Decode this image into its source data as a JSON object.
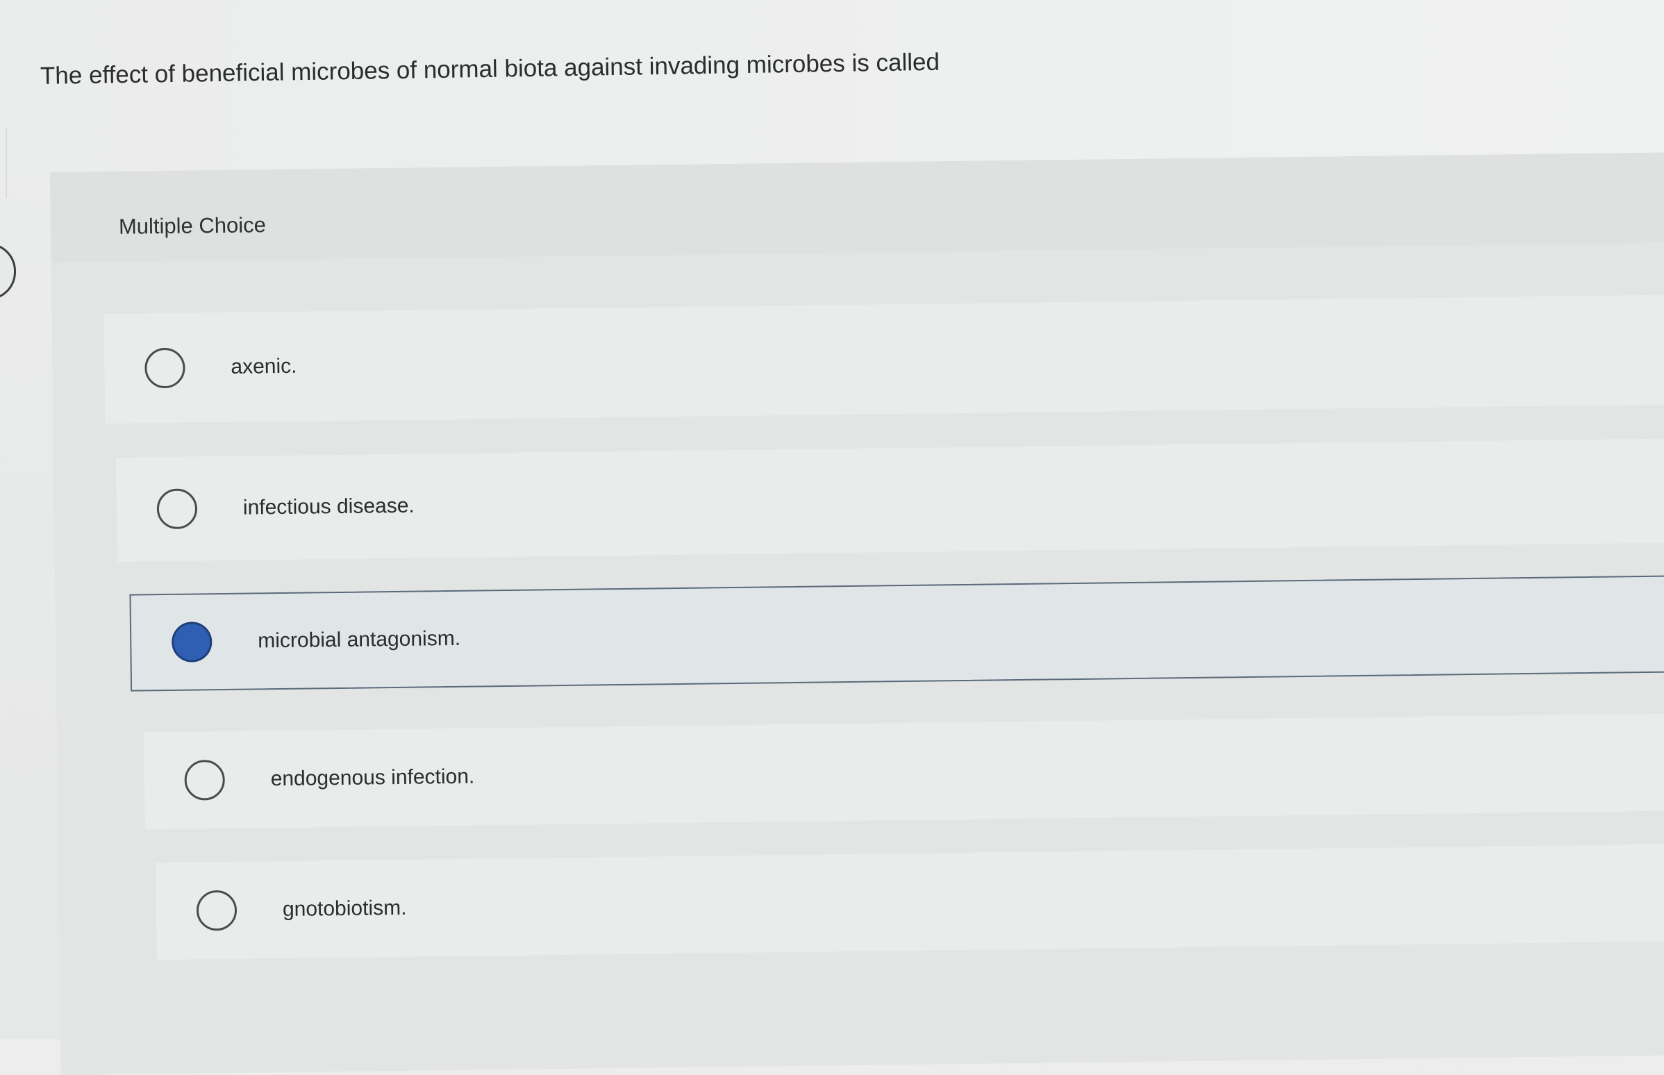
{
  "question": {
    "text": "The effect of beneficial microbes of normal biota against invading microbes is called"
  },
  "panel": {
    "header_label": "Multiple Choice"
  },
  "options": [
    {
      "label": "axenic.",
      "selected": false
    },
    {
      "label": "infectious disease.",
      "selected": false
    },
    {
      "label": "microbial antagonism.",
      "selected": true
    },
    {
      "label": "endogenous infection.",
      "selected": false
    },
    {
      "label": "gnotobiotism.",
      "selected": false
    }
  ],
  "colors": {
    "selected_radio": "#2f5fb3",
    "selected_border": "#5a6a7a"
  },
  "icons": {
    "unselected": "radio-empty-icon",
    "selected": "radio-filled-icon"
  }
}
